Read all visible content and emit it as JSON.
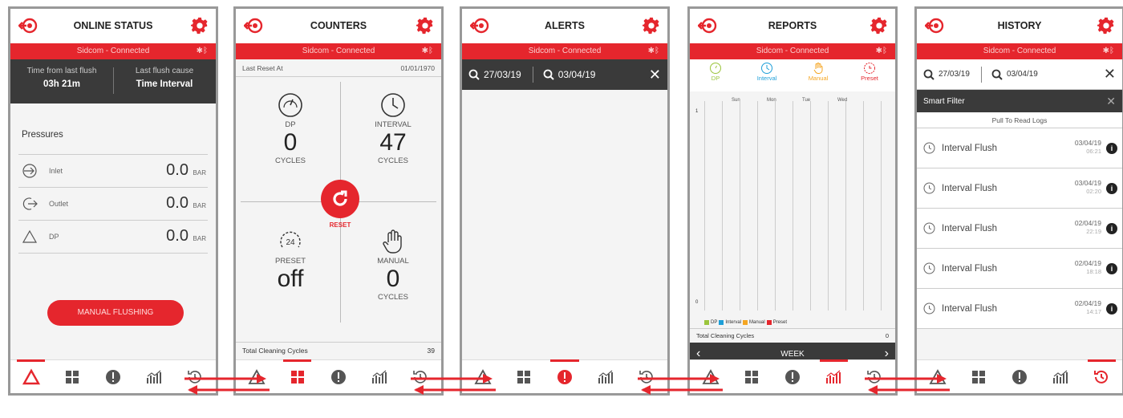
{
  "colors": {
    "accent": "#e5262d",
    "dark": "#3a3a3a",
    "frame": "#999999"
  },
  "screens": {
    "online": {
      "title": "ONLINE STATUS",
      "connection": "Sidcom - Connected",
      "flush": {
        "time_label": "Time from last flush",
        "time_value": "03h 21m",
        "cause_label": "Last flush cause",
        "cause_value": "Time Interval"
      },
      "pressures_title": "Pressures",
      "pressures": [
        {
          "name": "Inlet",
          "value": "0.0",
          "unit": "BAR"
        },
        {
          "name": "Outlet",
          "value": "0.0",
          "unit": "BAR"
        },
        {
          "name": "DP",
          "value": "0.0",
          "unit": "BAR"
        }
      ],
      "manual_button": "MANUAL FLUSHING"
    },
    "counters": {
      "title": "COUNTERS",
      "connection": "Sidcom - Connected",
      "reset_label": "Last Reset At",
      "reset_date": "01/01/1970",
      "dp": {
        "label": "DP",
        "value": "0",
        "unit": "CYCLES"
      },
      "interval": {
        "label": "INTERVAL",
        "value": "47",
        "unit": "CYCLES"
      },
      "preset": {
        "label": "PRESET",
        "value": "off",
        "icon_text": "24"
      },
      "manual": {
        "label": "MANUAL",
        "value": "0",
        "unit": "CYCLES"
      },
      "reset_button": "RESET",
      "total_label": "Total Cleaning Cycles",
      "total_value": "39"
    },
    "alerts": {
      "title": "ALERTS",
      "connection": "Sidcom - Connected",
      "date_from": "27/03/19",
      "date_to": "03/04/19"
    },
    "reports": {
      "title": "REPORTS",
      "connection": "Sidcom - Connected",
      "tabs": [
        "DP",
        "Interval",
        "Manual",
        "Preset"
      ],
      "days": [
        "Sun",
        "Mon",
        "Tue",
        "Wed"
      ],
      "y_top": "1",
      "y_bottom": "0",
      "legend": [
        "DP",
        "Interval",
        "Manual",
        "Preset"
      ],
      "total_label": "Total Cleaning Cycles",
      "total_value": "0",
      "period": "WEEK"
    },
    "history": {
      "title": "HISTORY",
      "connection": "Sidcom - Connected",
      "date_from": "27/03/19",
      "date_to": "03/04/19",
      "filter_label": "Smart Filter",
      "pull_label": "Pull To Read Logs",
      "logs": [
        {
          "name": "Interval Flush",
          "date": "03/04/19",
          "time": "06:21"
        },
        {
          "name": "Interval Flush",
          "date": "03/04/19",
          "time": "02:20"
        },
        {
          "name": "Interval Flush",
          "date": "02/04/19",
          "time": "22:19"
        },
        {
          "name": "Interval Flush",
          "date": "02/04/19",
          "time": "18:18"
        },
        {
          "name": "Interval Flush",
          "date": "02/04/19",
          "time": "14:17"
        }
      ]
    }
  },
  "icons": [
    "back-icon",
    "gear-icon",
    "bluetooth-icon",
    "delta-icon",
    "grid-icon",
    "alert-icon",
    "chart-icon",
    "history-icon",
    "search-icon",
    "close-icon",
    "clock-icon",
    "hand-icon",
    "gauge-icon",
    "reset-icon",
    "info-icon",
    "arrow-icon"
  ]
}
